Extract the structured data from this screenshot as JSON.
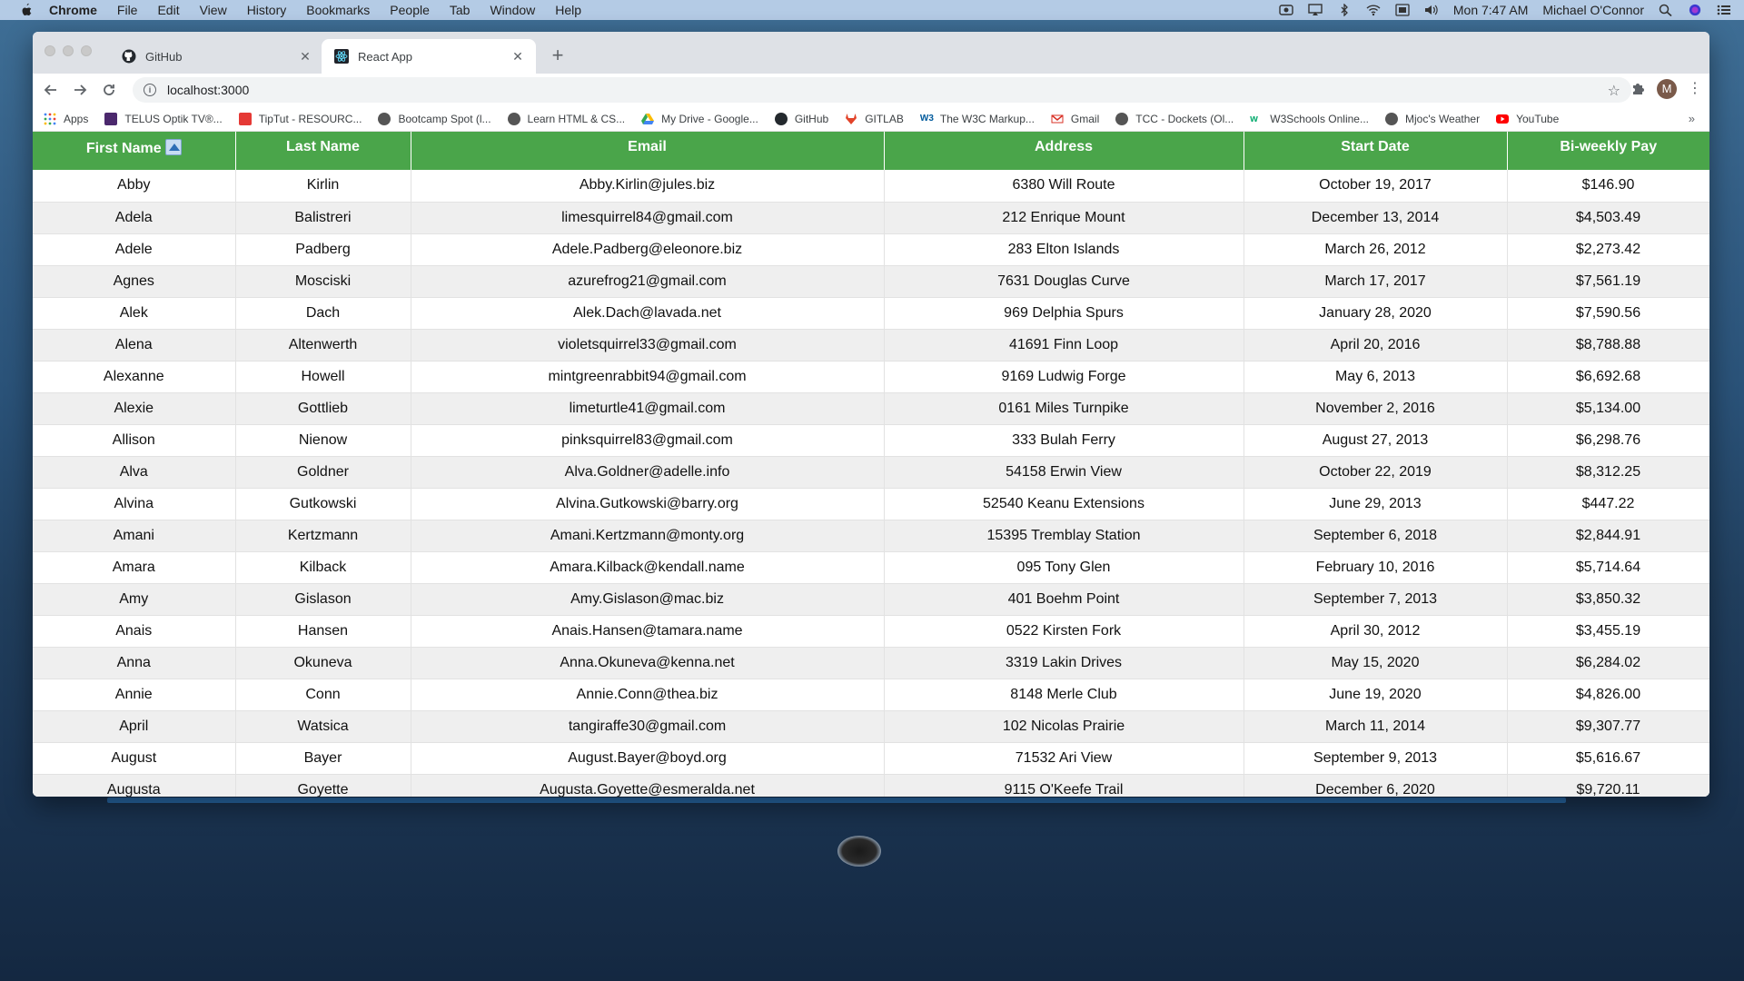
{
  "menubar": {
    "app": "Chrome",
    "items": [
      "File",
      "Edit",
      "View",
      "History",
      "Bookmarks",
      "People",
      "Tab",
      "Window",
      "Help"
    ],
    "clock": "Mon 7:47 AM",
    "user": "Michael O'Connor"
  },
  "tabs": [
    {
      "title": "GitHub",
      "icon": "github-icon"
    },
    {
      "title": "React App",
      "icon": "react-icon"
    }
  ],
  "address": {
    "url": "localhost:3000"
  },
  "profile_initial": "M",
  "bookmarks": [
    {
      "label": "Apps",
      "color": "#4285f4"
    },
    {
      "label": "TELUS Optik TV®...",
      "color": "#4b286d"
    },
    {
      "label": "TipTut - RESOURC...",
      "color": "#e53935"
    },
    {
      "label": "Bootcamp Spot (l...",
      "color": "#555555"
    },
    {
      "label": "Learn HTML & CS...",
      "color": "#555555"
    },
    {
      "label": "My Drive - Google...",
      "color": "#fbbc04"
    },
    {
      "label": "GitHub",
      "color": "#24292e"
    },
    {
      "label": "GITLAB",
      "color": "#e24329"
    },
    {
      "label": "The W3C Markup...",
      "color": "#005a9c"
    },
    {
      "label": "Gmail",
      "color": "#d93025"
    },
    {
      "label": "TCC - Dockets (Ol...",
      "color": "#555555"
    },
    {
      "label": "W3Schools Online...",
      "color": "#04aa6d"
    },
    {
      "label": "Mjoc's Weather",
      "color": "#555555"
    },
    {
      "label": "YouTube",
      "color": "#ff0000"
    }
  ],
  "table": {
    "headers": [
      "First Name",
      "Last Name",
      "Email",
      "Address",
      "Start Date",
      "Bi-weekly Pay"
    ],
    "rows": [
      [
        "Abby",
        "Kirlin",
        "Abby.Kirlin@jules.biz",
        "6380 Will Route",
        "October 19, 2017",
        "$146.90"
      ],
      [
        "Adela",
        "Balistreri",
        "limesquirrel84@gmail.com",
        "212 Enrique Mount",
        "December 13, 2014",
        "$4,503.49"
      ],
      [
        "Adele",
        "Padberg",
        "Adele.Padberg@eleonore.biz",
        "283 Elton Islands",
        "March 26, 2012",
        "$2,273.42"
      ],
      [
        "Agnes",
        "Mosciski",
        "azurefrog21@gmail.com",
        "7631 Douglas Curve",
        "March 17, 2017",
        "$7,561.19"
      ],
      [
        "Alek",
        "Dach",
        "Alek.Dach@lavada.net",
        "969 Delphia Spurs",
        "January 28, 2020",
        "$7,590.56"
      ],
      [
        "Alena",
        "Altenwerth",
        "violetsquirrel33@gmail.com",
        "41691 Finn Loop",
        "April 20, 2016",
        "$8,788.88"
      ],
      [
        "Alexanne",
        "Howell",
        "mintgreenrabbit94@gmail.com",
        "9169 Ludwig Forge",
        "May 6, 2013",
        "$6,692.68"
      ],
      [
        "Alexie",
        "Gottlieb",
        "limeturtle41@gmail.com",
        "0161 Miles Turnpike",
        "November 2, 2016",
        "$5,134.00"
      ],
      [
        "Allison",
        "Nienow",
        "pinksquirrel83@gmail.com",
        "333 Bulah Ferry",
        "August 27, 2013",
        "$6,298.76"
      ],
      [
        "Alva",
        "Goldner",
        "Alva.Goldner@adelle.info",
        "54158 Erwin View",
        "October 22, 2019",
        "$8,312.25"
      ],
      [
        "Alvina",
        "Gutkowski",
        "Alvina.Gutkowski@barry.org",
        "52540 Keanu Extensions",
        "June 29, 2013",
        "$447.22"
      ],
      [
        "Amani",
        "Kertzmann",
        "Amani.Kertzmann@monty.org",
        "15395 Tremblay Station",
        "September 6, 2018",
        "$2,844.91"
      ],
      [
        "Amara",
        "Kilback",
        "Amara.Kilback@kendall.name",
        "095 Tony Glen",
        "February 10, 2016",
        "$5,714.64"
      ],
      [
        "Amy",
        "Gislason",
        "Amy.Gislason@mac.biz",
        "401 Boehm Point",
        "September 7, 2013",
        "$3,850.32"
      ],
      [
        "Anais",
        "Hansen",
        "Anais.Hansen@tamara.name",
        "0522 Kirsten Fork",
        "April 30, 2012",
        "$3,455.19"
      ],
      [
        "Anna",
        "Okuneva",
        "Anna.Okuneva@kenna.net",
        "3319 Lakin Drives",
        "May 15, 2020",
        "$6,284.02"
      ],
      [
        "Annie",
        "Conn",
        "Annie.Conn@thea.biz",
        "8148 Merle Club",
        "June 19, 2020",
        "$4,826.00"
      ],
      [
        "April",
        "Watsica",
        "tangiraffe30@gmail.com",
        "102 Nicolas Prairie",
        "March 11, 2014",
        "$9,307.77"
      ],
      [
        "August",
        "Bayer",
        "August.Bayer@boyd.org",
        "71532 Ari View",
        "September 9, 2013",
        "$5,616.67"
      ],
      [
        "Augusta",
        "Goyette",
        "Augusta.Goyette@esmeralda.net",
        "9115 O'Keefe Trail",
        "December 6, 2020",
        "$9,720.11"
      ]
    ]
  },
  "colors": {
    "header_bg": "#4aa54a",
    "header_text": "#ffffff",
    "row_alt": "#efefef"
  }
}
